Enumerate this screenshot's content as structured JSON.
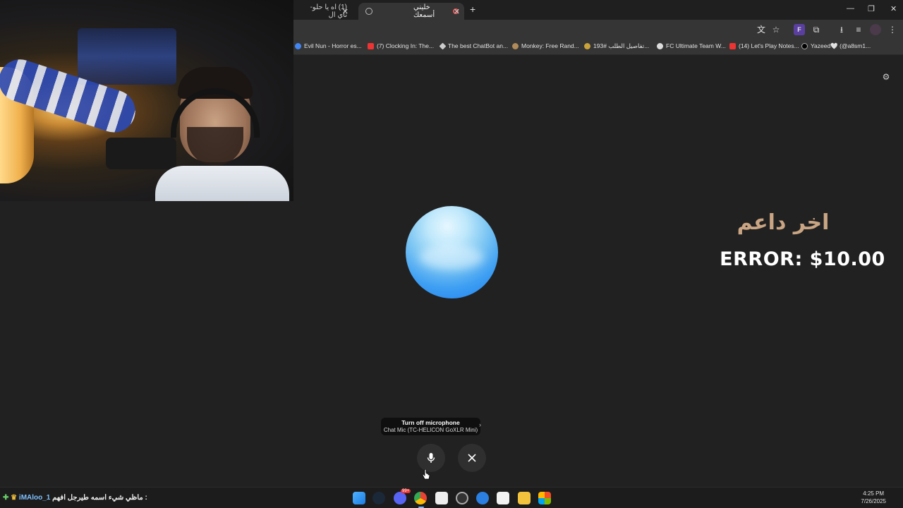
{
  "browser": {
    "tabs": [
      {
        "label": "(1) اه يا حلو- ناي ال"
      },
      {
        "label": "خليني أسمعك"
      }
    ],
    "bookmarks": [
      {
        "label": "Evil Nun - Horror es..."
      },
      {
        "label": "(7) Clocking In: The..."
      },
      {
        "label": "The best ChatBot an..."
      },
      {
        "label": "Monkey: Free Rand..."
      },
      {
        "label": "تفاصيل الطلب #193..."
      },
      {
        "label": "FC Ultimate Team W..."
      },
      {
        "label": "(14) Let's Play Notes..."
      },
      {
        "label": "Yazeed🤍 (@a8sm1..."
      }
    ]
  },
  "stream": {
    "donor_title": "اخر داعم",
    "donation_text": "ERROR: $10.00"
  },
  "voice": {
    "tooltip_title": "Turn off microphone",
    "tooltip_subtitle": "Chat Mic (TC-HELICON GoXLR Mini)"
  },
  "taskbar": {
    "ticker_text": "ماظي شيء اسمه طيرجل افهم :",
    "ticker_name": "iMAloo_1",
    "time": "4:25 PM",
    "date": "7/26/2025",
    "discord_badge": "99+"
  },
  "colors": {
    "background": "#212121",
    "donor_title": "#c9a583",
    "orb_blue": "#1e7df0"
  }
}
